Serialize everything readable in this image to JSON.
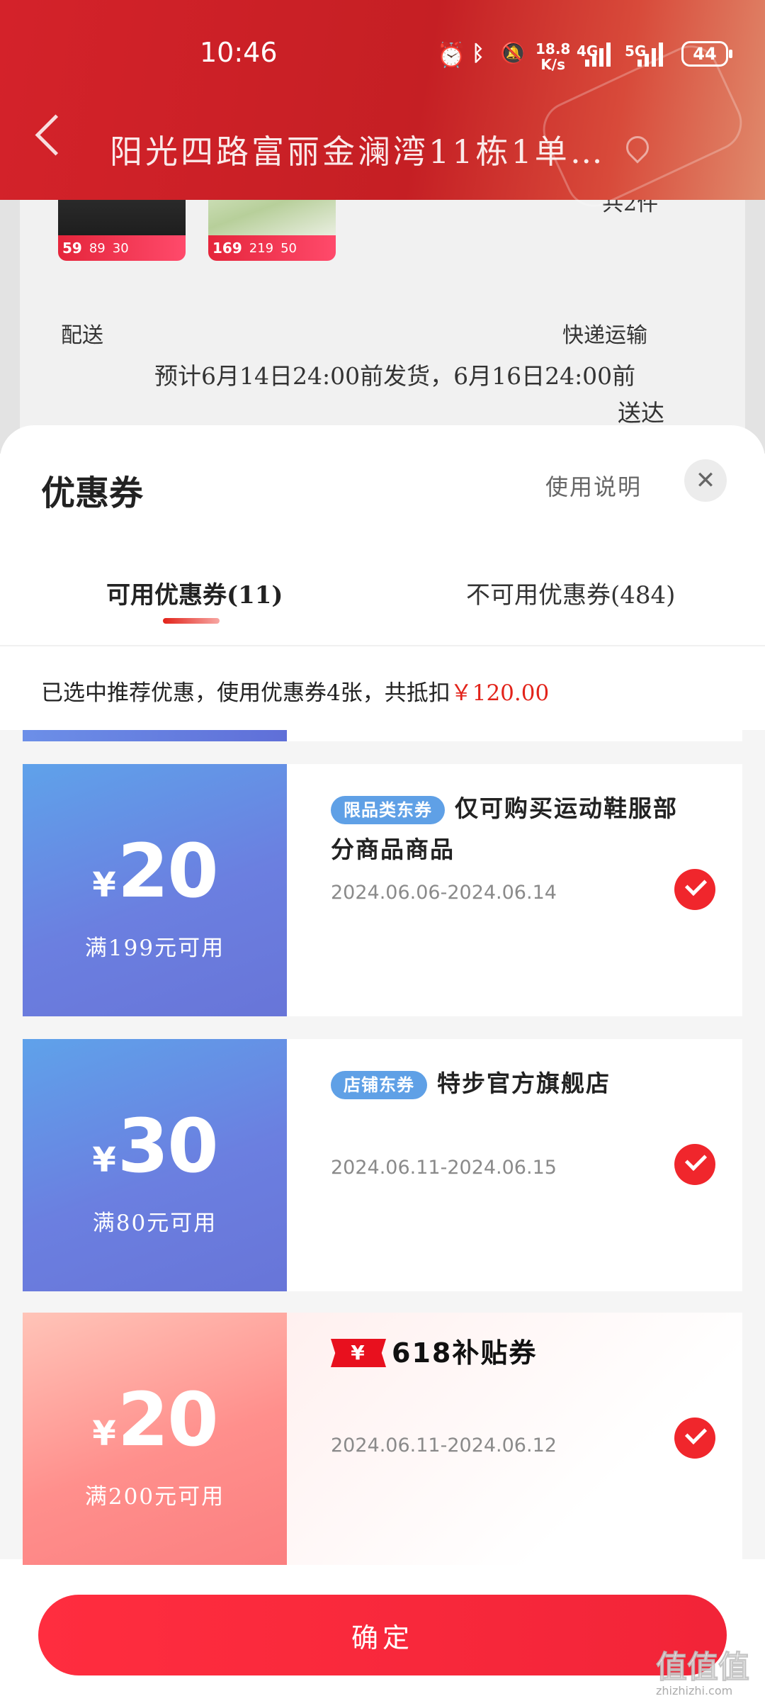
{
  "status_bar": {
    "time": "10:46",
    "net_speed_top": "18.8",
    "net_speed_bottom": "K/s",
    "signal_1": "4G",
    "signal_2": "5G",
    "battery": "44"
  },
  "header": {
    "address": "阳光四路富丽金澜湾11栋1单…"
  },
  "background_order": {
    "products": [
      {
        "price": "59",
        "p2": "89",
        "p3": "30"
      },
      {
        "price": "169",
        "p2": "219",
        "p3": "50"
      }
    ],
    "count_text": "共2件",
    "delivery_label": "配送",
    "delivery_method": "快递运输",
    "delivery_eta_line1": "预计6月14日24:00前发货，6月16日24:00前",
    "delivery_eta_line2": "送达"
  },
  "sheet": {
    "title": "优惠券",
    "usage_link": "使用说明",
    "close_icon": "close-icon",
    "tabs": [
      {
        "label": "可用优惠券(11)"
      },
      {
        "label": "不可用优惠券(484)"
      }
    ],
    "summary_prefix": "已选中推荐优惠，使用优惠券4张，共抵扣",
    "summary_amount": "￥120.00"
  },
  "coupons": [
    {
      "currency": "¥",
      "value": "20",
      "condition": "满199元可用",
      "tag": "限品类东券",
      "title": "仅可购买运动鞋服部分商品商品",
      "date": "2024.06.06-2024.06.14",
      "selected": true
    },
    {
      "currency": "¥",
      "value": "30",
      "condition": "满80元可用",
      "tag": "店铺东券",
      "title": "特步官方旗舰店",
      "date": "2024.06.11-2024.06.15",
      "selected": true
    },
    {
      "currency": "¥",
      "value": "20",
      "condition": "满200元可用",
      "badge": "¥",
      "title": "618补贴券",
      "date": "2024.06.11-2024.06.12",
      "selected": true
    }
  ],
  "confirm_button": "确定",
  "watermark": {
    "text": "值值值",
    "url": "zhizhizhi.com"
  },
  "colors": {
    "accent": "#e2231a",
    "header_red": "#c51f24",
    "coupon_blue": "#6b7fe0",
    "coupon_pink": "#fb7f80",
    "confirm": "#f22438"
  }
}
